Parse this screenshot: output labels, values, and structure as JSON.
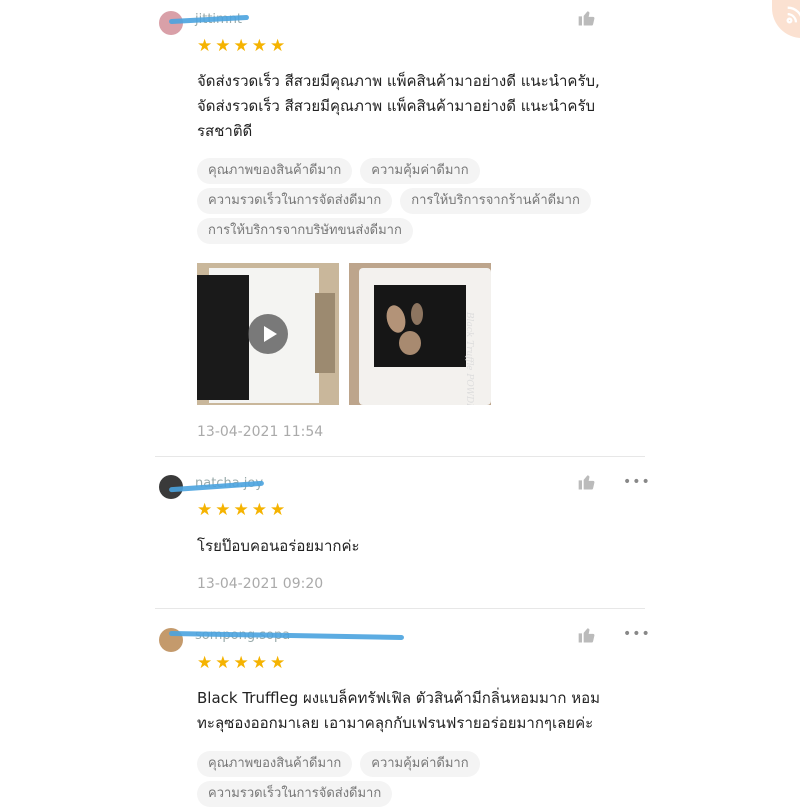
{
  "reviews": [
    {
      "username": "jittimnt",
      "stars": "★★★★★",
      "body": "จัดส่งรวดเร็ว สีสวยมีคุณภาพ แพ็คสินค้ามาอย่างดี แนะนำครับ,\nจัดส่งรวดเร็ว สีสวยมีคุณภาพ แพ็คสินค้ามาอย่างดี แนะนำครับ\nรสชาติดี",
      "tags": [
        "คุณภาพของสินค้าดีมาก",
        "ความคุ้มค่าดีมาก",
        "ความรวดเร็วในการจัดส่งดีมาก",
        "การให้บริการจากร้านค้าดีมาก",
        "การให้บริการจากบริษัทขนส่งดีมาก"
      ],
      "media": [
        {
          "type": "video",
          "icon": "play-icon"
        },
        {
          "type": "image",
          "text": "Black Truffle POWDER"
        }
      ],
      "date": "13-04-2021 11:54"
    },
    {
      "username": "natcha.joy",
      "stars": "★★★★★",
      "body": "โรยป๊อบคอนอร่อยมากค่ะ",
      "date": "13-04-2021 09:20"
    },
    {
      "username": "sompong.sopa",
      "stars": "★★★★★",
      "body": "Black Truffleg ผงแบล็คทรัฟเฟิล  ตัวสินค้ามีกลิ่นหอมมาก หอม\nทะลุซองออกมาเลย เอามาคลุกกับเฟรนฟรายอร่อยมากๆเลยค่ะ",
      "tags": [
        "คุณภาพของสินค้าดีมาก",
        "ความคุ้มค่าดีมาก",
        "ความรวดเร็วในการจัดส่งดีมาก"
      ]
    }
  ],
  "icons": {
    "like": "thumbs-up-icon",
    "more": "more-options-icon"
  },
  "colors": {
    "star": "#f5b301",
    "tag_bg": "#f4f4f4",
    "scribble": "#4aa3df"
  },
  "more_glyph": "•••"
}
